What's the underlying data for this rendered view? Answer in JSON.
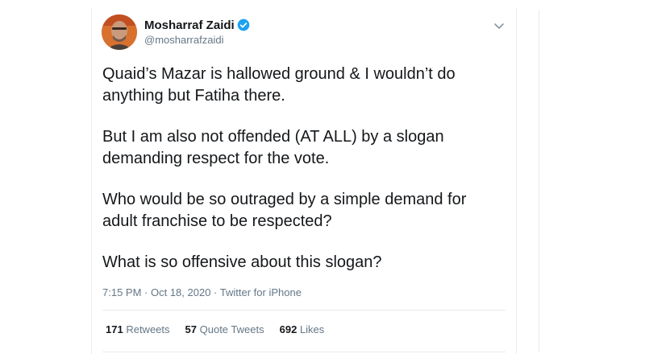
{
  "tweet": {
    "author_name": "Mosharraf Zaidi",
    "author_handle": "@mosharrafzaidi",
    "paragraphs": [
      "Quaid’s Mazar is hallowed ground & I wouldn’t do anything but Fatiha there.",
      "But I am also not offended (AT ALL) by a slogan demanding respect for the vote.",
      "Who would be so outraged by a simple demand for adult franchise to be respected?",
      "What is so offensive about this slogan?"
    ],
    "time": "7:15 PM",
    "date": "Oct 18, 2020",
    "source": "Twitter for iPhone",
    "separator": " · "
  },
  "stats": {
    "retweets_count": "171",
    "retweets_label": "Retweets",
    "quotes_count": "57",
    "quotes_label": "Quote Tweets",
    "likes_count": "692",
    "likes_label": "Likes"
  },
  "icons": {
    "verified": "verified-badge-icon",
    "menu": "chevron-down-icon"
  },
  "colors": {
    "verified_blue": "#1da1f2",
    "text": "#14171a",
    "muted": "#657786",
    "border": "#e6ecf0"
  }
}
